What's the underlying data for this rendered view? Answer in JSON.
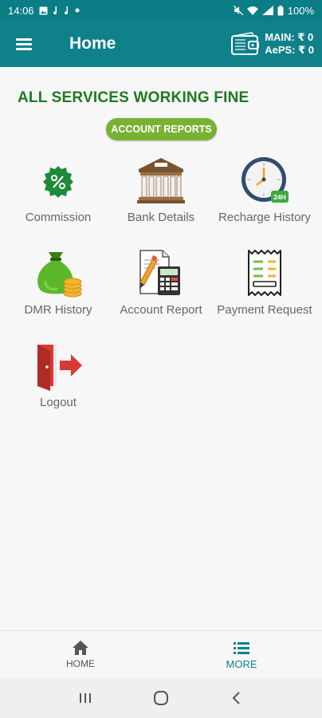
{
  "status_bar": {
    "time": "14:06",
    "battery": "100%"
  },
  "app_bar": {
    "title": "Home",
    "main_balance": "MAIN: ₹ 0",
    "aeps_balance": "AePS: ₹ 0"
  },
  "headline": "ALL SERVICES WORKING FINE",
  "report_button": "ACCOUNT REPORTS",
  "tiles": [
    {
      "label": "Commission",
      "icon": "percent-badge-icon"
    },
    {
      "label": "Bank Details",
      "icon": "bank-icon"
    },
    {
      "label": "Recharge History",
      "icon": "clock-24h-icon"
    },
    {
      "label": "DMR History",
      "icon": "money-bag-icon"
    },
    {
      "label": "Account Report",
      "icon": "calculator-report-icon"
    },
    {
      "label": "Payment Request",
      "icon": "receipt-icon"
    },
    {
      "label": "Logout",
      "icon": "logout-icon"
    }
  ],
  "bottom_nav": {
    "home_label": "HOME",
    "more_label": "MORE",
    "active": "MORE"
  },
  "colors": {
    "primary": "#10808b",
    "headline": "#1d7a1f",
    "pill": "#78b235"
  }
}
